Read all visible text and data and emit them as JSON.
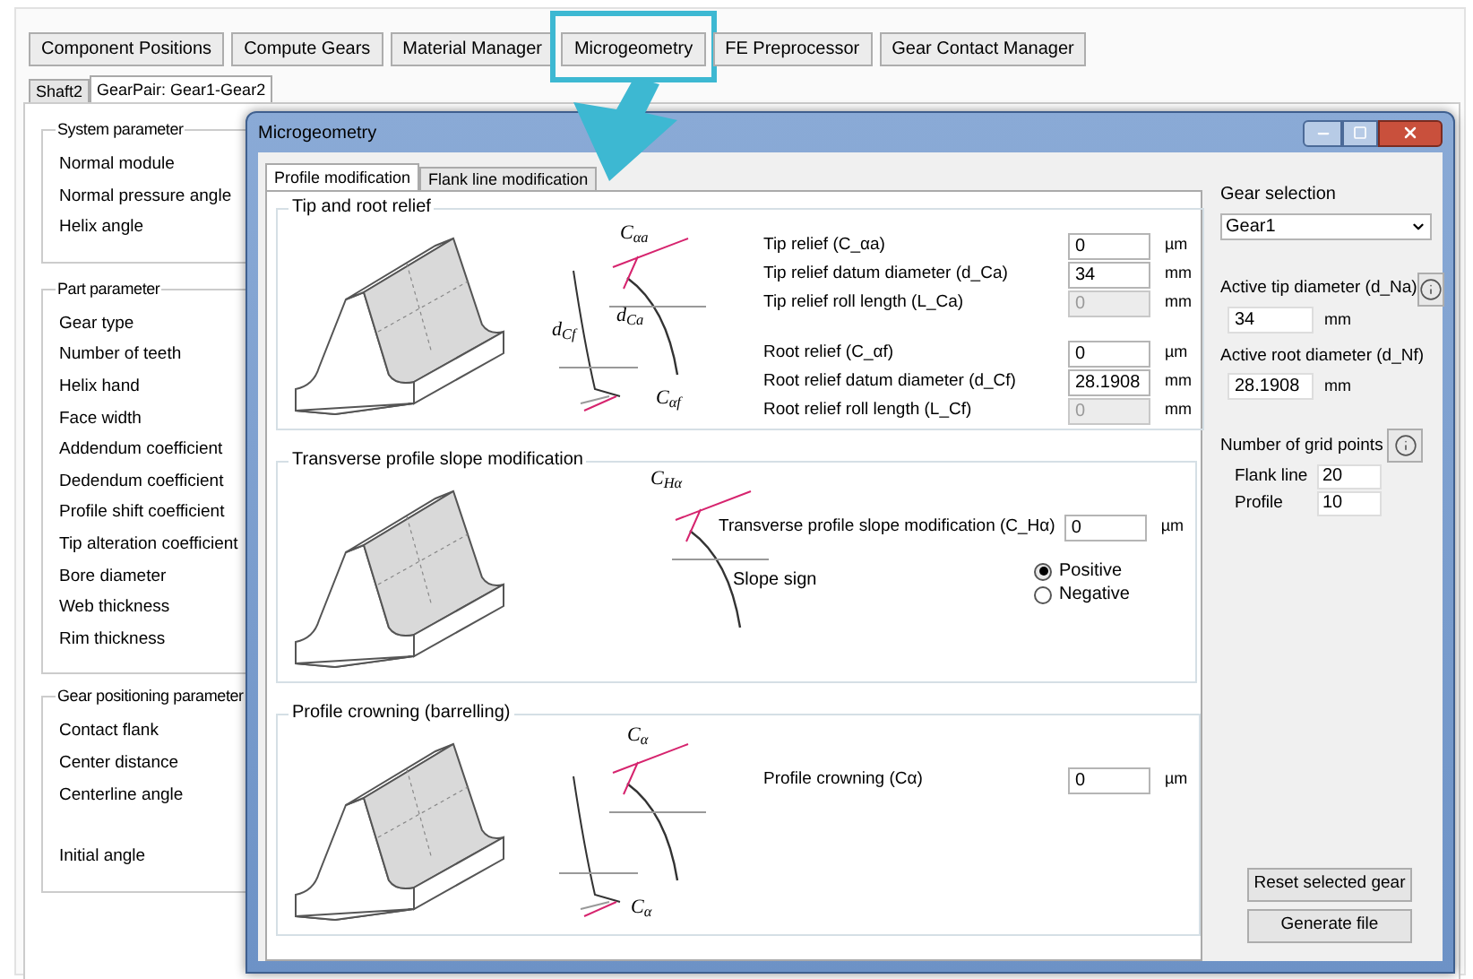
{
  "top_tabs": [
    {
      "label": "Component Positions",
      "highlighted": false
    },
    {
      "label": "Compute Gears",
      "highlighted": false
    },
    {
      "label": "Material Manager",
      "highlighted": false
    },
    {
      "label": "Microgeometry",
      "highlighted": true
    },
    {
      "label": "FE Preprocessor",
      "highlighted": false
    },
    {
      "label": "Gear Contact Manager",
      "highlighted": false
    }
  ],
  "sub_tabs": [
    {
      "label": "Shaft2",
      "selected": false
    },
    {
      "label": "GearPair: Gear1-Gear2",
      "selected": true
    }
  ],
  "groups": [
    {
      "title": "System parameter",
      "rows": [
        "Normal module",
        "Normal pressure angle",
        "Helix angle"
      ]
    },
    {
      "title": "Part parameter",
      "rows": [
        "Gear type",
        "Number of teeth",
        "Helix hand",
        "Face width",
        "Addendum coefficient",
        "Dedendum coefficient",
        "Profile shift coefficient",
        "Tip alteration coefficient",
        "Bore diameter",
        "Web thickness",
        "Rim thickness"
      ]
    },
    {
      "title": "Gear positioning parameter",
      "rows": [
        "Contact flank",
        "Center distance",
        "Centerline angle"
      ],
      "rows_after_gap": [
        "Initial angle"
      ]
    }
  ],
  "dialog": {
    "title": "Microgeometry",
    "tabs": [
      {
        "label": "Profile modification",
        "selected": true
      },
      {
        "label": "Flank line modification",
        "selected": false
      }
    ],
    "sections": [
      {
        "title": "Tip and root relief",
        "kind": "relief",
        "diagram_labels": [
          "d$_{Cf}$",
          "C$_{αa}$",
          "d$_{Ca}$",
          "C$_{αf}$"
        ],
        "field_groups": [
          [
            {
              "label": "Tip relief (C_αa)",
              "value": "0",
              "unit": "µm",
              "disabled": false
            },
            {
              "label": "Tip relief datum diameter (d_Ca)",
              "value": "34",
              "unit": "mm",
              "disabled": false
            },
            {
              "label": "Tip relief roll length (L_Ca)",
              "value": "0",
              "unit": "mm",
              "disabled": true
            }
          ],
          [
            {
              "label": "Root relief (C_αf)",
              "value": "0",
              "unit": "µm",
              "disabled": false
            },
            {
              "label": "Root relief datum diameter (d_Cf)",
              "value": "28.1908",
              "unit": "mm",
              "disabled": false
            },
            {
              "label": "Root relief roll length (L_Cf)",
              "value": "0",
              "unit": "mm",
              "disabled": true
            }
          ]
        ]
      },
      {
        "title": "Transverse profile slope modification",
        "kind": "slope",
        "diagram_labels": [
          "C$_{Hα}$"
        ],
        "field_groups": [
          [
            {
              "label": "Transverse profile slope modification (C_Hα)",
              "value": "0",
              "unit": "µm",
              "disabled": false
            }
          ]
        ],
        "radio": {
          "label": "Slope sign",
          "options": [
            {
              "label": "Positive",
              "selected": true
            },
            {
              "label": "Negative",
              "selected": false
            }
          ]
        }
      },
      {
        "title": "Profile crowning (barrelling)",
        "kind": "crowning",
        "diagram_labels": [
          "C$_{α}$",
          "C$_{α}$"
        ],
        "field_groups": [
          [
            {
              "label": "Profile crowning (Cα)",
              "value": "0",
              "unit": "µm",
              "disabled": false
            }
          ]
        ]
      }
    ],
    "side": {
      "gear_selection_label": "Gear selection",
      "gear_value": "Gear1",
      "tip_label": "Active tip diameter (d_Na)",
      "tip_value": "34",
      "tip_unit": "mm",
      "root_label": "Active root diameter (d_Nf)",
      "root_value": "28.1908",
      "root_unit": "mm",
      "grid_label": "Number of grid points",
      "grid_rows": [
        {
          "label": "Flank line",
          "value": "20"
        },
        {
          "label": "Profile",
          "value": "10"
        }
      ]
    },
    "buttons": [
      "Reset selected gear",
      "Generate file"
    ]
  }
}
